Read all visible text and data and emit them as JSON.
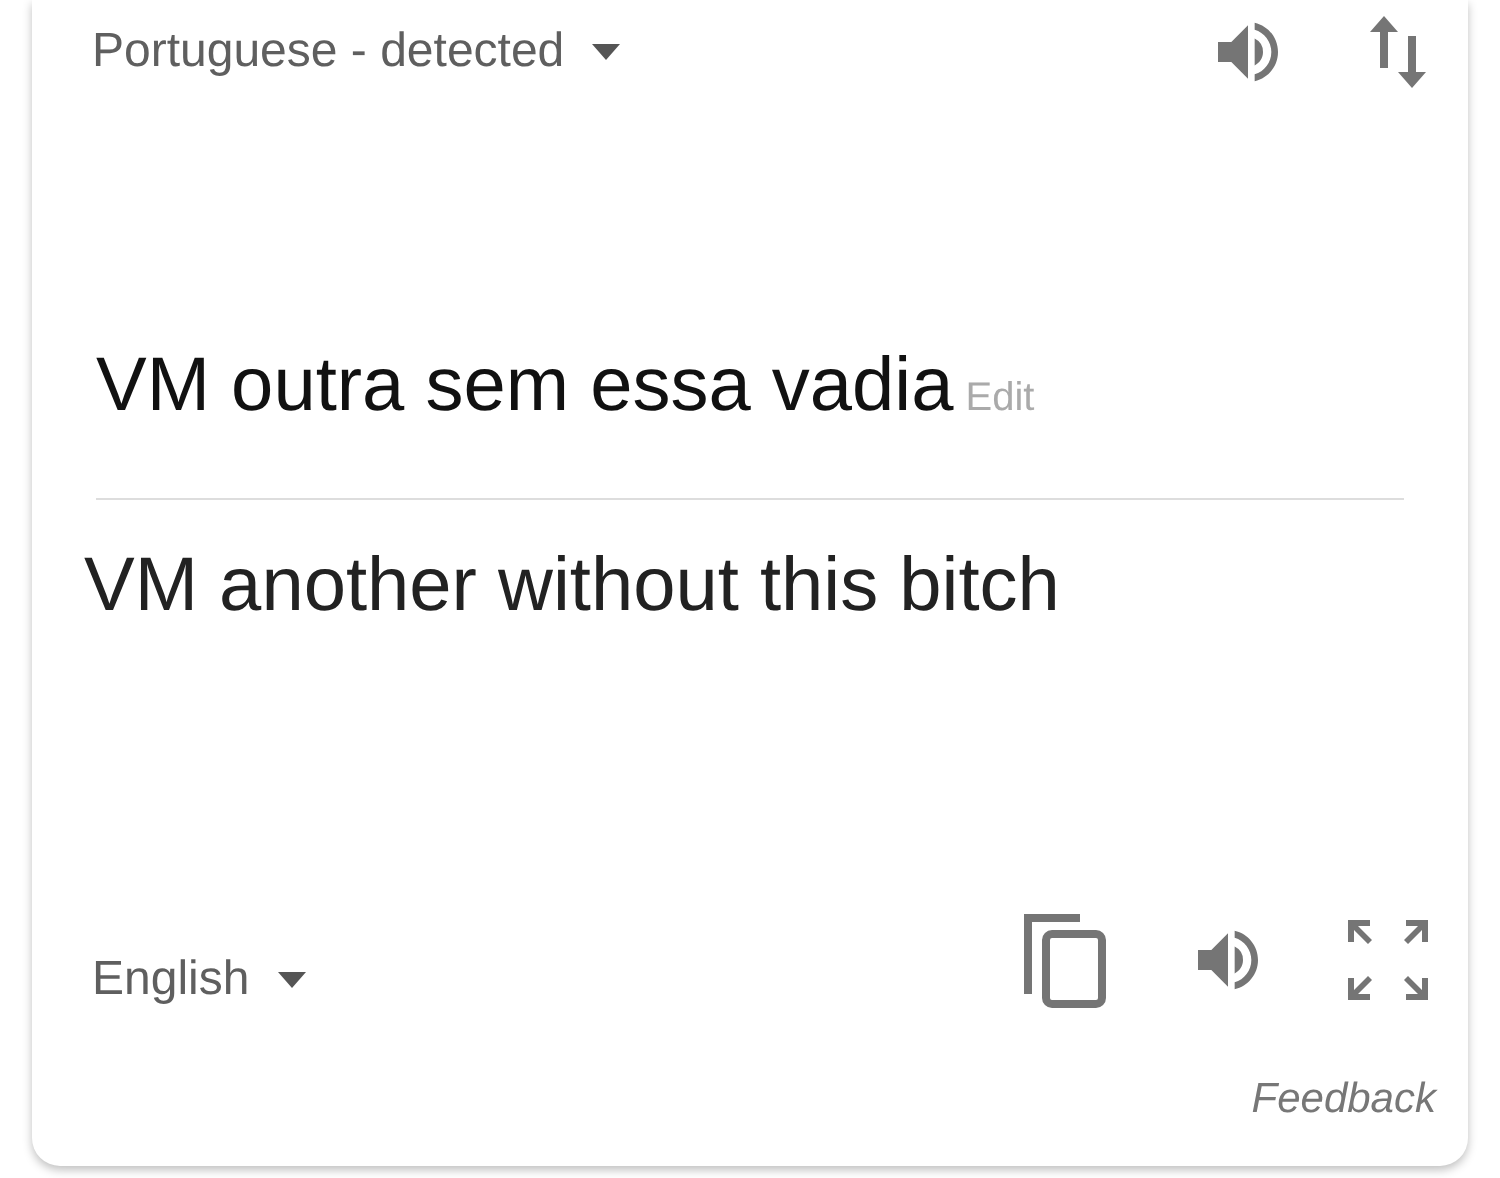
{
  "source": {
    "language": "Portuguese - detected",
    "text": "VM outra sem essa vadia",
    "edit_link": "Edit"
  },
  "target": {
    "text": "VM another without this bitch",
    "language": "English"
  },
  "feedback": "Feedback"
}
